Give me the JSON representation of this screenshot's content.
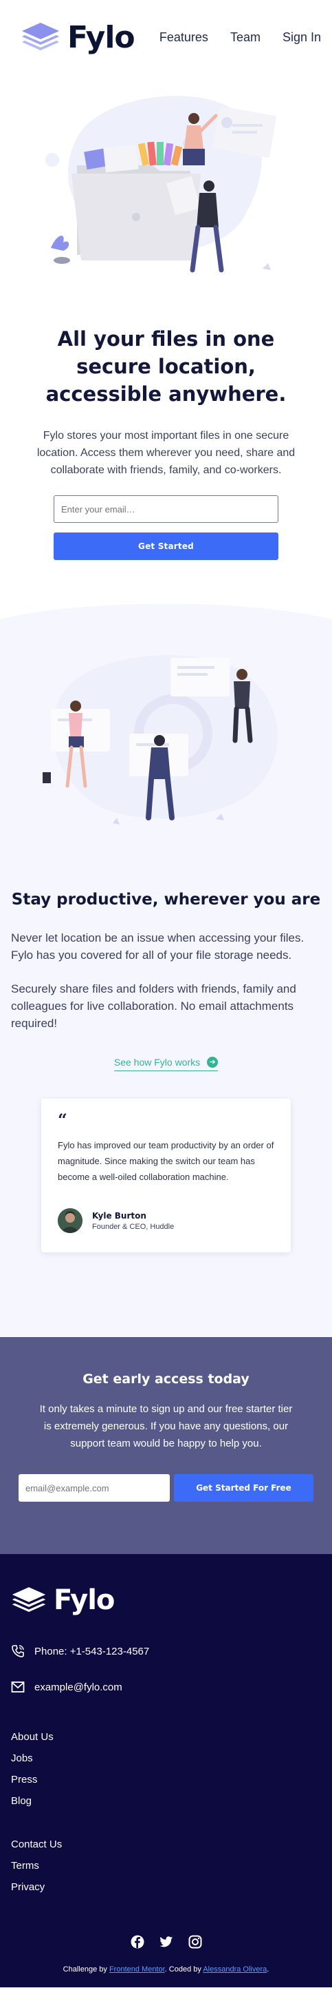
{
  "header": {
    "brand": "Fylo",
    "nav": [
      "Features",
      "Team",
      "Sign In"
    ]
  },
  "hero": {
    "title": "All your files in one secure location, accessible anywhere.",
    "text": "Fylo stores your most important files in one secure location. Access them wherever you need, share and collaborate with friends, family, and co-workers.",
    "email_placeholder": "Enter your email…",
    "button": "Get Started"
  },
  "productive": {
    "title": "Stay productive, wherever you are",
    "paragraph_1": "Never let location be an issue when accessing your files. Fylo has you covered for all of your file storage needs.",
    "paragraph_2": "Securely share files and folders with friends, family and colleagues for live collaboration. No email attachments required!",
    "link": "See how Fylo works",
    "testimonial": {
      "quote_mark": "“",
      "quote": "Fylo has improved our team productivity by an order of magnitude. Since making the switch our team has become a well-oiled collaboration machine.",
      "name": "Kyle Burton",
      "role": "Founder & CEO, Huddle"
    }
  },
  "early_access": {
    "title": "Get early access today",
    "text": "It only takes a minute to sign up and our free starter tier is extremely generous. If you have any questions, our support team would be happy to help you.",
    "email_placeholder": "email@example.com",
    "button": "Get Started For Free"
  },
  "footer": {
    "brand": "Fylo",
    "phone": "Phone: +1-543-123-4567",
    "email": "example@fylo.com",
    "links_1": [
      "About Us",
      "Jobs",
      "Press",
      "Blog"
    ],
    "links_2": [
      "Contact Us",
      "Terms",
      "Privacy"
    ],
    "socials": [
      "facebook-icon",
      "twitter-icon",
      "instagram-icon"
    ],
    "attribution": {
      "prefix": "Challenge by ",
      "challenge_link": "Frontend Mentor",
      "middle": ". Coded by ",
      "author_link": "Alessandra Olivera",
      "suffix": "."
    }
  },
  "colors": {
    "primary_blue": "#3c6cf7",
    "accent_teal": "#36b293",
    "early_bg": "#575a89",
    "footer_bg": "#0c0a3e",
    "section_bg": "#f6f7fe"
  }
}
